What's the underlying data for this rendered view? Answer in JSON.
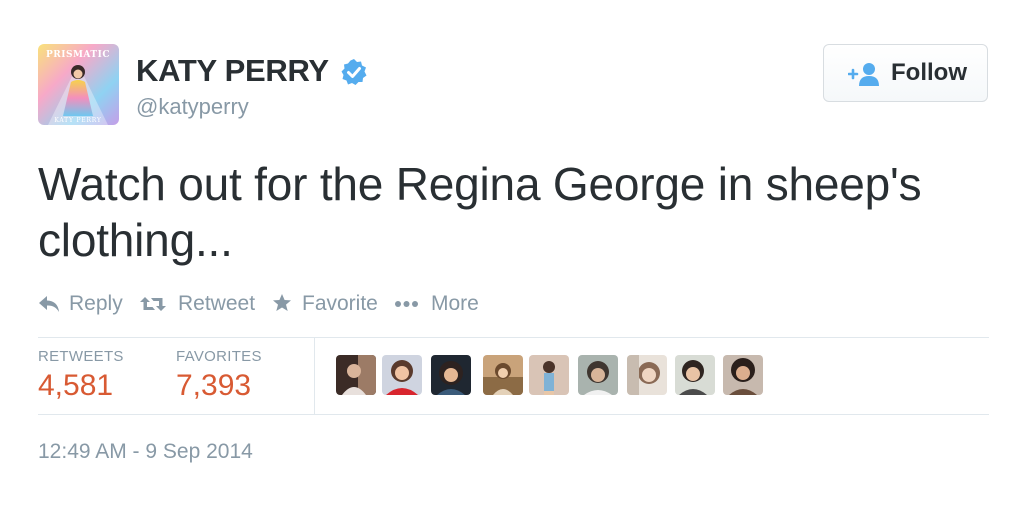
{
  "user": {
    "avatar_text_top": "PRISMATIC",
    "avatar_text_bottom": "KATY PERRY",
    "name": "KATY PERRY",
    "handle": "@katyperry",
    "verified_icon": "verified-badge-icon"
  },
  "follow_button": {
    "label": "Follow",
    "icon": "add-user-icon"
  },
  "tweet": {
    "text": "Watch out for the Regina George in sheep's clothing..."
  },
  "actions": {
    "reply": "Reply",
    "retweet": "Retweet",
    "favorite": "Favorite",
    "more": "More"
  },
  "stats": {
    "retweets_label": "RETWEETS",
    "retweets_value": "4,581",
    "favorites_label": "FAVORITES",
    "favorites_value": "7,393"
  },
  "timestamp": "12:49 AM - 9 Sep 2014",
  "colors": {
    "accent_stat": "#d85a33",
    "muted": "#8899a6",
    "verified": "#55acee",
    "text": "#292f33"
  }
}
